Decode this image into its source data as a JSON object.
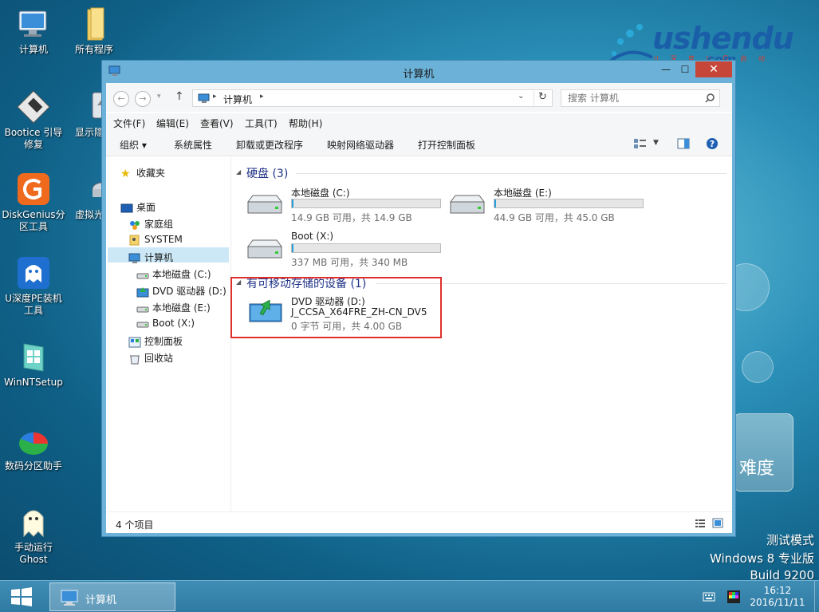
{
  "desktop": {
    "brand": {
      "logo": "ushendu",
      "sub": ".com",
      "tag": "U 深 度 U 盘 启 动"
    },
    "icons": [
      {
        "label": "计算机"
      },
      {
        "label": "所有程序"
      },
      {
        "label": "Bootice 引导修复"
      },
      {
        "label": "显示隐藏"
      },
      {
        "label": "DiskGenius分区工具"
      },
      {
        "label": "虚拟光驱"
      },
      {
        "label": "U深度PE装机工具"
      },
      {
        "label": "WinNTSetup"
      },
      {
        "label": "数码分区助手"
      },
      {
        "label": "手动运行Ghost"
      }
    ],
    "game_button": "难度",
    "watermark": {
      "line1": "测试模式",
      "line2": "Windows 8 专业版",
      "line3": "Build 9200"
    }
  },
  "window": {
    "title": "计算机",
    "nav": {
      "breadcrumb": "计算机",
      "search_placeholder": "搜索 计算机"
    },
    "menu": [
      "文件(F)",
      "编辑(E)",
      "查看(V)",
      "工具(T)",
      "帮助(H)"
    ],
    "commands": [
      "组织 ▾",
      "系统属性",
      "卸载或更改程序",
      "映射网络驱动器",
      "打开控制面板"
    ],
    "tree": {
      "favorites": "收藏夹",
      "desktop": "桌面",
      "homegroup": "家庭组",
      "system": "SYSTEM",
      "computer": "计算机",
      "c": "本地磁盘 (C:)",
      "d": "DVD 驱动器 (D:)",
      "e": "本地磁盘 (E:)",
      "x": "Boot (X:)",
      "control": "控制面板",
      "recycle": "回收站"
    },
    "groups": {
      "hdd": "硬盘 (3)",
      "removable": "有可移动存储的设备 (1)"
    },
    "drives": {
      "c": {
        "name": "本地磁盘 (C:)",
        "stats": "14.9 GB 可用，共 14.9 GB",
        "used": 0.01
      },
      "e": {
        "name": "本地磁盘 (E:)",
        "stats": "44.9 GB 可用，共 45.0 GB",
        "used": 0.01
      },
      "x": {
        "name": "Boot (X:)",
        "stats": "337 MB 可用，共 340 MB",
        "used": 0.01
      },
      "d": {
        "name": "DVD 驱动器 (D:)",
        "label": "J_CCSA_X64FRE_ZH-CN_DV5",
        "stats": "0 字节 可用，共 4.00 GB"
      }
    },
    "status": "4 个项目"
  },
  "taskbar": {
    "task": "计算机",
    "time": "16:12",
    "date": "2016/11/11"
  }
}
